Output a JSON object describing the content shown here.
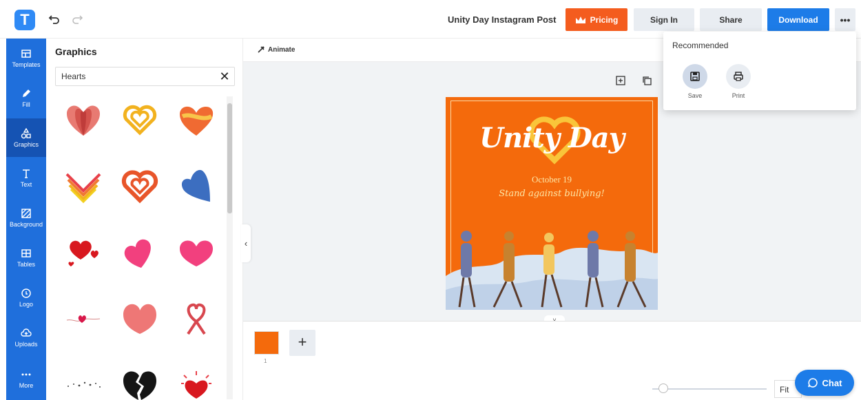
{
  "topbar": {
    "logo_letter": "T",
    "doc_title": "Unity Day Instagram Post",
    "pricing_label": "Pricing",
    "signin_label": "Sign In",
    "share_label": "Share",
    "download_label": "Download",
    "more_label": "•••"
  },
  "sidebar": {
    "items": [
      {
        "label": "Templates",
        "icon": "templates-icon"
      },
      {
        "label": "Fill",
        "icon": "pencil-icon"
      },
      {
        "label": "Graphics",
        "icon": "shapes-icon",
        "active": true
      },
      {
        "label": "Text",
        "icon": "text-icon"
      },
      {
        "label": "Background",
        "icon": "background-icon"
      },
      {
        "label": "Tables",
        "icon": "table-icon"
      },
      {
        "label": "Logo",
        "icon": "logo-icon"
      },
      {
        "label": "Uploads",
        "icon": "cloud-upload-icon"
      },
      {
        "label": "More",
        "icon": "more-dots-icon"
      }
    ]
  },
  "panel": {
    "title": "Graphics",
    "search_value": "Hearts",
    "clear_label": "✕"
  },
  "canvas": {
    "animate_label": "Animate",
    "design_title": "Unity Day",
    "design_date": "October 19",
    "design_tagline": "Stand against bullying!",
    "page_number": "1",
    "add_page_label": "+",
    "collapse_label": "‹",
    "expand_label": "˅"
  },
  "zoom": {
    "fit_label": "Fit"
  },
  "chat": {
    "label": "Chat"
  },
  "dropdown": {
    "title": "Recommended",
    "items": [
      {
        "label": "Save",
        "icon": "save-icon"
      },
      {
        "label": "Print",
        "icon": "print-icon"
      }
    ]
  },
  "colors": {
    "brand_blue": "#1f6fdc",
    "pricing_orange": "#f45c1e",
    "download_blue": "#1d7ce8",
    "design_orange": "#f46a0c"
  }
}
